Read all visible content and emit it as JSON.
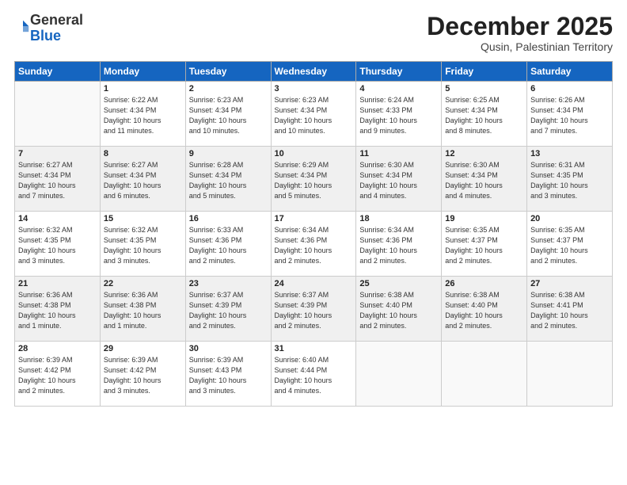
{
  "logo": {
    "general": "General",
    "blue": "Blue"
  },
  "title": "December 2025",
  "location": "Qusin, Palestinian Territory",
  "days_of_week": [
    "Sunday",
    "Monday",
    "Tuesday",
    "Wednesday",
    "Thursday",
    "Friday",
    "Saturday"
  ],
  "weeks": [
    [
      {
        "day": "",
        "info": ""
      },
      {
        "day": "1",
        "info": "Sunrise: 6:22 AM\nSunset: 4:34 PM\nDaylight: 10 hours\nand 11 minutes."
      },
      {
        "day": "2",
        "info": "Sunrise: 6:23 AM\nSunset: 4:34 PM\nDaylight: 10 hours\nand 10 minutes."
      },
      {
        "day": "3",
        "info": "Sunrise: 6:23 AM\nSunset: 4:34 PM\nDaylight: 10 hours\nand 10 minutes."
      },
      {
        "day": "4",
        "info": "Sunrise: 6:24 AM\nSunset: 4:33 PM\nDaylight: 10 hours\nand 9 minutes."
      },
      {
        "day": "5",
        "info": "Sunrise: 6:25 AM\nSunset: 4:34 PM\nDaylight: 10 hours\nand 8 minutes."
      },
      {
        "day": "6",
        "info": "Sunrise: 6:26 AM\nSunset: 4:34 PM\nDaylight: 10 hours\nand 7 minutes."
      }
    ],
    [
      {
        "day": "7",
        "info": "Sunrise: 6:27 AM\nSunset: 4:34 PM\nDaylight: 10 hours\nand 7 minutes."
      },
      {
        "day": "8",
        "info": "Sunrise: 6:27 AM\nSunset: 4:34 PM\nDaylight: 10 hours\nand 6 minutes."
      },
      {
        "day": "9",
        "info": "Sunrise: 6:28 AM\nSunset: 4:34 PM\nDaylight: 10 hours\nand 5 minutes."
      },
      {
        "day": "10",
        "info": "Sunrise: 6:29 AM\nSunset: 4:34 PM\nDaylight: 10 hours\nand 5 minutes."
      },
      {
        "day": "11",
        "info": "Sunrise: 6:30 AM\nSunset: 4:34 PM\nDaylight: 10 hours\nand 4 minutes."
      },
      {
        "day": "12",
        "info": "Sunrise: 6:30 AM\nSunset: 4:34 PM\nDaylight: 10 hours\nand 4 minutes."
      },
      {
        "day": "13",
        "info": "Sunrise: 6:31 AM\nSunset: 4:35 PM\nDaylight: 10 hours\nand 3 minutes."
      }
    ],
    [
      {
        "day": "14",
        "info": "Sunrise: 6:32 AM\nSunset: 4:35 PM\nDaylight: 10 hours\nand 3 minutes."
      },
      {
        "day": "15",
        "info": "Sunrise: 6:32 AM\nSunset: 4:35 PM\nDaylight: 10 hours\nand 3 minutes."
      },
      {
        "day": "16",
        "info": "Sunrise: 6:33 AM\nSunset: 4:36 PM\nDaylight: 10 hours\nand 2 minutes."
      },
      {
        "day": "17",
        "info": "Sunrise: 6:34 AM\nSunset: 4:36 PM\nDaylight: 10 hours\nand 2 minutes."
      },
      {
        "day": "18",
        "info": "Sunrise: 6:34 AM\nSunset: 4:36 PM\nDaylight: 10 hours\nand 2 minutes."
      },
      {
        "day": "19",
        "info": "Sunrise: 6:35 AM\nSunset: 4:37 PM\nDaylight: 10 hours\nand 2 minutes."
      },
      {
        "day": "20",
        "info": "Sunrise: 6:35 AM\nSunset: 4:37 PM\nDaylight: 10 hours\nand 2 minutes."
      }
    ],
    [
      {
        "day": "21",
        "info": "Sunrise: 6:36 AM\nSunset: 4:38 PM\nDaylight: 10 hours\nand 1 minute."
      },
      {
        "day": "22",
        "info": "Sunrise: 6:36 AM\nSunset: 4:38 PM\nDaylight: 10 hours\nand 1 minute."
      },
      {
        "day": "23",
        "info": "Sunrise: 6:37 AM\nSunset: 4:39 PM\nDaylight: 10 hours\nand 2 minutes."
      },
      {
        "day": "24",
        "info": "Sunrise: 6:37 AM\nSunset: 4:39 PM\nDaylight: 10 hours\nand 2 minutes."
      },
      {
        "day": "25",
        "info": "Sunrise: 6:38 AM\nSunset: 4:40 PM\nDaylight: 10 hours\nand 2 minutes."
      },
      {
        "day": "26",
        "info": "Sunrise: 6:38 AM\nSunset: 4:40 PM\nDaylight: 10 hours\nand 2 minutes."
      },
      {
        "day": "27",
        "info": "Sunrise: 6:38 AM\nSunset: 4:41 PM\nDaylight: 10 hours\nand 2 minutes."
      }
    ],
    [
      {
        "day": "28",
        "info": "Sunrise: 6:39 AM\nSunset: 4:42 PM\nDaylight: 10 hours\nand 2 minutes."
      },
      {
        "day": "29",
        "info": "Sunrise: 6:39 AM\nSunset: 4:42 PM\nDaylight: 10 hours\nand 3 minutes."
      },
      {
        "day": "30",
        "info": "Sunrise: 6:39 AM\nSunset: 4:43 PM\nDaylight: 10 hours\nand 3 minutes."
      },
      {
        "day": "31",
        "info": "Sunrise: 6:40 AM\nSunset: 4:44 PM\nDaylight: 10 hours\nand 4 minutes."
      },
      {
        "day": "",
        "info": ""
      },
      {
        "day": "",
        "info": ""
      },
      {
        "day": "",
        "info": ""
      }
    ]
  ]
}
